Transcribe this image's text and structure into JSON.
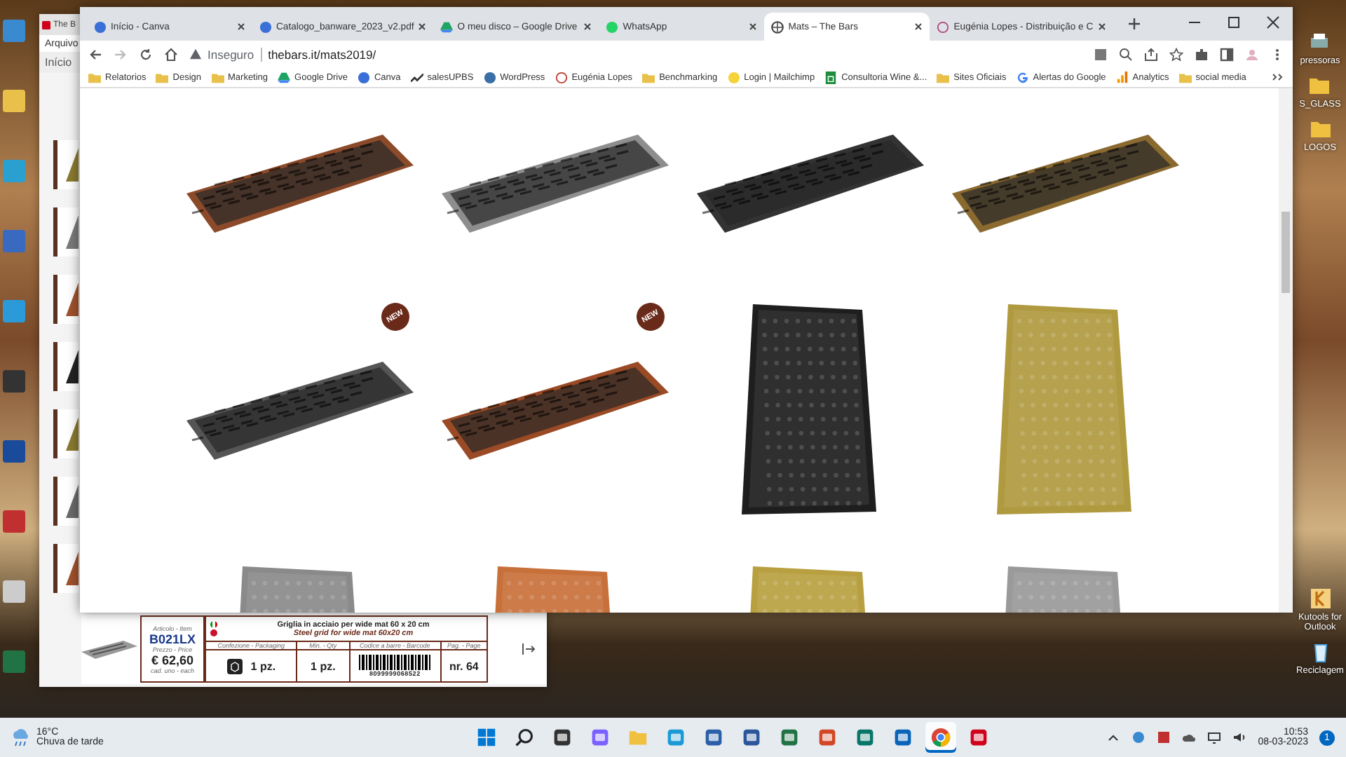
{
  "desktop": {
    "icons_right": [
      {
        "label": "pressoras",
        "kind": "printer"
      },
      {
        "label": "S_GLASS",
        "kind": "folder"
      },
      {
        "label": "LOGOS",
        "kind": "folder"
      },
      {
        "label": "Kutools for Outlook",
        "kind": "kutools"
      },
      {
        "label": "Reciclagem",
        "kind": "bin"
      }
    ]
  },
  "pdf_window": {
    "tab": "The B",
    "menu": [
      "Arquivo"
    ],
    "toolbar_tab": "Início",
    "thumbnails": [
      {
        "color": "#8a7a30"
      },
      {
        "color": "#7a7a7a"
      },
      {
        "color": "#a0522d"
      },
      {
        "color": "#222222"
      },
      {
        "color": "#8a7a30"
      },
      {
        "color": "#6a6a6a"
      },
      {
        "color": "#a0522d"
      }
    ],
    "product": {
      "item_label": "Articolo - Item",
      "item": "B021LX",
      "price_label": "Prezzo - Price",
      "price": "€ 62,60",
      "price_unit": "cad. uno - each",
      "title_it": "Griglia in acciaio per wide mat 60 x 20 cm",
      "title_en": "Steel grid for wide mat 60x20 cm",
      "columns": [
        {
          "label": "Confezione - Packaging",
          "value": "1 pz."
        },
        {
          "label": "Min. - Qty",
          "value": "1 pz."
        },
        {
          "label": "Codice a barre - Barcode",
          "value": "8099999068522"
        },
        {
          "label": "Pag. - Page",
          "value": "nr. 64"
        }
      ]
    }
  },
  "browser": {
    "tabs": [
      {
        "title": "Início - Canva",
        "kind": "canva",
        "selected": false
      },
      {
        "title": "Catalogo_banware_2023_v2.pdf",
        "kind": "canva",
        "selected": false
      },
      {
        "title": "O meu disco – Google Drive",
        "kind": "drive",
        "selected": false
      },
      {
        "title": "WhatsApp",
        "kind": "whatsapp",
        "selected": false
      },
      {
        "title": "Mats – The Bars",
        "kind": "globe",
        "selected": true
      },
      {
        "title": "Eugénia Lopes - Distribuição e C",
        "kind": "loading",
        "selected": false
      }
    ],
    "security": "Inseguro",
    "url": "thebars.it/mats2019/",
    "bookmarks": [
      {
        "label": "Relatorios",
        "kind": "folder"
      },
      {
        "label": "Design",
        "kind": "folder"
      },
      {
        "label": "Marketing",
        "kind": "folder"
      },
      {
        "label": "Google Drive",
        "kind": "drive"
      },
      {
        "label": "Canva",
        "kind": "canva"
      },
      {
        "label": "salesUPBS",
        "kind": "sales"
      },
      {
        "label": "WordPress",
        "kind": "wordpress"
      },
      {
        "label": "Eugénia Lopes",
        "kind": "ring"
      },
      {
        "label": "Benchmarking",
        "kind": "folder"
      },
      {
        "label": "Login | Mailchimp",
        "kind": "mailchimp"
      },
      {
        "label": "Consultoria Wine &...",
        "kind": "sheets"
      },
      {
        "label": "Sites Oficiais",
        "kind": "folder"
      },
      {
        "label": "Alertas do Google",
        "kind": "google"
      },
      {
        "label": "Analytics",
        "kind": "analytics"
      },
      {
        "label": "social media",
        "kind": "folder"
      }
    ],
    "products": [
      {
        "kind": "tray",
        "color": "#8b4a2a"
      },
      {
        "kind": "tray",
        "color": "#8e8e8e"
      },
      {
        "kind": "tray",
        "color": "#333333"
      },
      {
        "kind": "tray",
        "color": "#8b6a30"
      },
      {
        "kind": "tray",
        "color": "#555555",
        "badge": "NEW"
      },
      {
        "kind": "tray",
        "color": "#9a4a25",
        "badge": "NEW"
      },
      {
        "kind": "rubber",
        "color": "#1e1e1e"
      },
      {
        "kind": "rubber",
        "color": "#b09a40"
      },
      {
        "kind": "rubber",
        "color": "#8a8a8a"
      },
      {
        "kind": "rubber",
        "color": "#c8703a"
      },
      {
        "kind": "rubber",
        "color": "#b8a040"
      },
      {
        "kind": "rubber",
        "color": "#9a9a9a"
      }
    ]
  },
  "taskbar": {
    "weather_temp": "16°C",
    "weather_text": "Chuva de tarde",
    "apps": [
      {
        "kind": "start",
        "selected": false
      },
      {
        "kind": "search",
        "selected": false
      },
      {
        "kind": "taskview",
        "selected": false
      },
      {
        "kind": "chat",
        "selected": false
      },
      {
        "kind": "explorer",
        "selected": false
      },
      {
        "kind": "edge",
        "selected": false
      },
      {
        "kind": "store",
        "selected": false
      },
      {
        "kind": "word",
        "selected": false
      },
      {
        "kind": "excel",
        "selected": false
      },
      {
        "kind": "powerpoint",
        "selected": false
      },
      {
        "kind": "publisher",
        "selected": false
      },
      {
        "kind": "outlook",
        "selected": false
      },
      {
        "kind": "chrome",
        "selected": true
      },
      {
        "kind": "acrobat",
        "selected": false
      }
    ],
    "time": "10:53",
    "date": "08-03-2023",
    "notifications": "1"
  }
}
